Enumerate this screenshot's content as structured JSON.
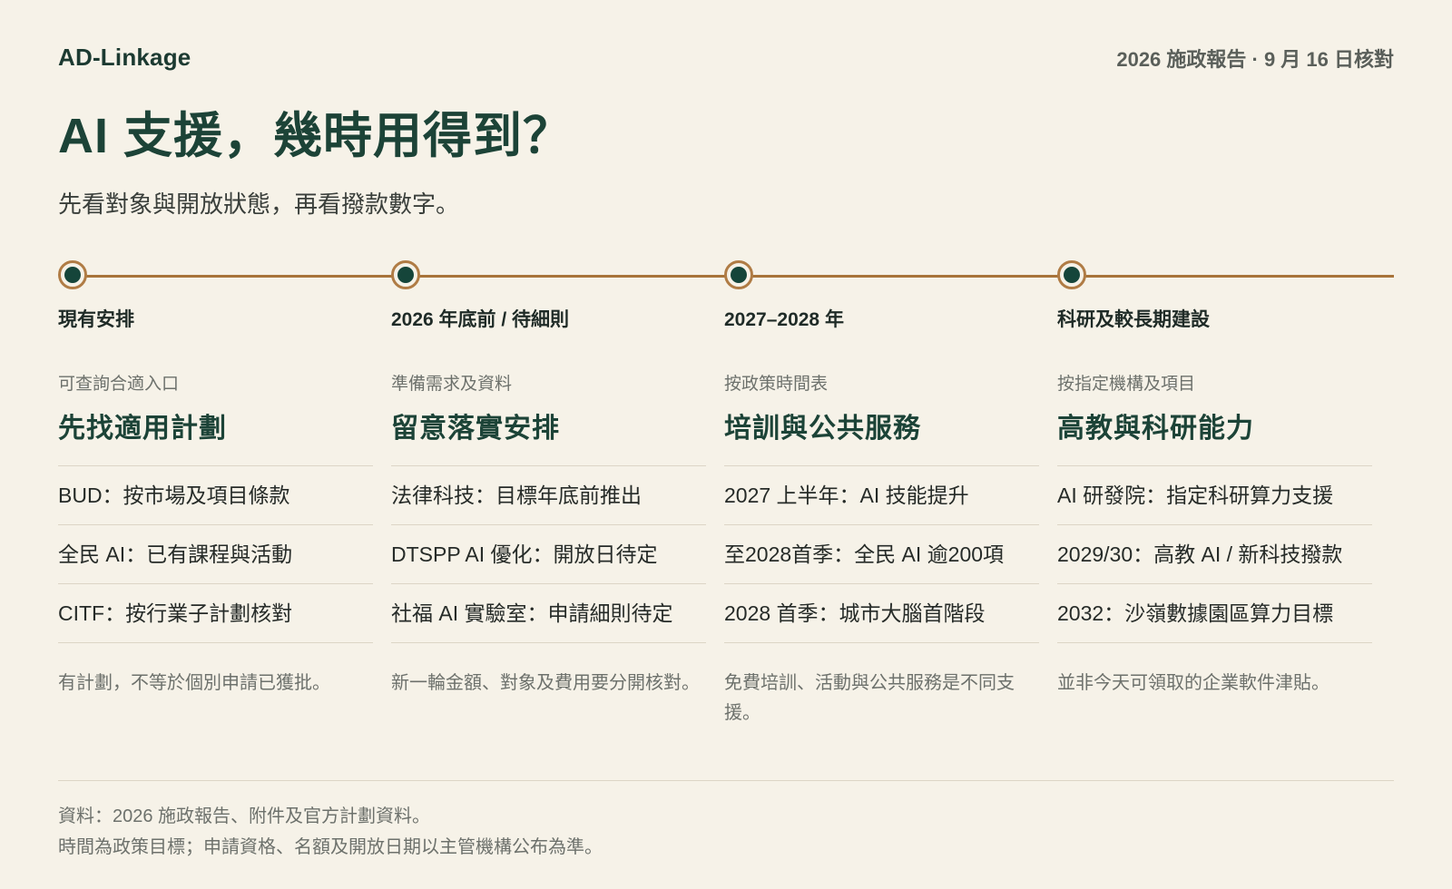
{
  "header": {
    "brand": "AD-Linkage",
    "meta": "2026 施政報告 · 9 月 16 日核對",
    "title": "AI 支援，幾時用得到？",
    "subtitle": "先看對象與開放狀態，再看撥款數字。"
  },
  "columns": [
    {
      "phase": "現有安排",
      "caption": "可查詢合適入口",
      "title": "先找適用計劃",
      "items": [
        "BUD：按市場及項目條款",
        "全民 AI：已有課程與活動",
        "CITF：按行業子計劃核對"
      ],
      "note": "有計劃，不等於個別申請已獲批。"
    },
    {
      "phase": "2026 年底前 / 待細則",
      "caption": "準備需求及資料",
      "title": "留意落實安排",
      "items": [
        "法律科技：目標年底前推出",
        "DTSPP AI 優化：開放日待定",
        "社福 AI 實驗室：申請細則待定"
      ],
      "note": "新一輪金額、對象及費用要分開核對。"
    },
    {
      "phase": "2027–2028 年",
      "caption": "按政策時間表",
      "title": "培訓與公共服務",
      "items": [
        "2027 上半年：AI 技能提升",
        "至2028首季：全民 AI 逾200項",
        "2028 首季：城市大腦首階段"
      ],
      "note": "免費培訓、活動與公共服務是不同支援。"
    },
    {
      "phase": "科研及較長期建設",
      "caption": "按指定機構及項目",
      "title": "高教與科研能力",
      "items": [
        "AI 研發院：指定科研算力支援",
        "2029/30：高教 AI / 新科技撥款",
        "2032：沙嶺數據園區算力目標"
      ],
      "note": "並非今天可領取的企業軟件津貼。"
    }
  ],
  "footer": {
    "source": "資料：2026 施政報告、附件及官方計劃資料。",
    "disclaimer": "時間為政策目標；申請資格、名額及開放日期以主管機構公布為準。"
  },
  "colors": {
    "background": "#f6f2e8",
    "accent_green": "#1c4337",
    "timeline_line": "#a8743a",
    "dot_fill": "#15453a"
  }
}
